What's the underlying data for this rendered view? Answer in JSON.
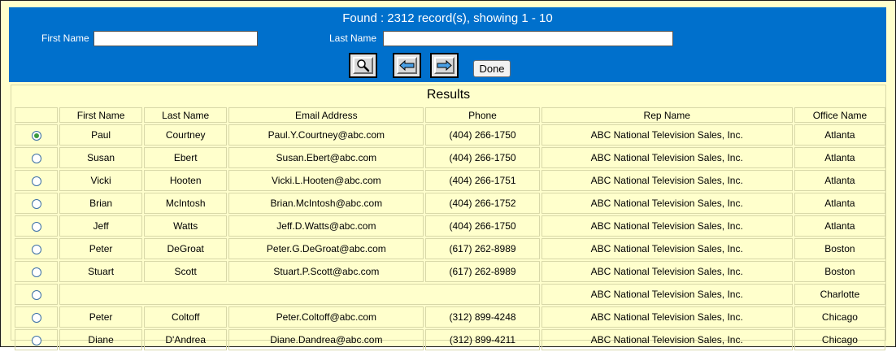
{
  "header": {
    "found_text": "Found : 2312 record(s), showing 1 - 10",
    "first_name_label": "First Name",
    "first_name_value": "",
    "last_name_label": "Last Name",
    "last_name_value": "",
    "search_icon": "magnifier-icon",
    "prev_icon": "arrow-left-icon",
    "next_icon": "arrow-right-icon",
    "done_label": "Done",
    "color": "#0070cc"
  },
  "results": {
    "title": "Results",
    "columns": [
      "",
      "First Name",
      "Last Name",
      "Email Address",
      "Phone",
      "Rep Name",
      "Office Name"
    ],
    "rows": [
      {
        "selected": true,
        "first": "Paul",
        "last": "Courtney",
        "email": "Paul.Y.Courtney@abc.com",
        "phone": "(404) 266-1750",
        "rep": "ABC National Television Sales, Inc.",
        "office": "Atlanta"
      },
      {
        "selected": false,
        "first": "Susan",
        "last": "Ebert",
        "email": "Susan.Ebert@abc.com",
        "phone": "(404) 266-1750",
        "rep": "ABC National Television Sales, Inc.",
        "office": "Atlanta"
      },
      {
        "selected": false,
        "first": "Vicki",
        "last": "Hooten",
        "email": "Vicki.L.Hooten@abc.com",
        "phone": "(404) 266-1751",
        "rep": "ABC National Television Sales, Inc.",
        "office": "Atlanta"
      },
      {
        "selected": false,
        "first": "Brian",
        "last": "McIntosh",
        "email": "Brian.McIntosh@abc.com",
        "phone": "(404) 266-1752",
        "rep": "ABC National Television Sales, Inc.",
        "office": "Atlanta"
      },
      {
        "selected": false,
        "first": "Jeff",
        "last": "Watts",
        "email": "Jeff.D.Watts@abc.com",
        "phone": "(404) 266-1750",
        "rep": "ABC National Television Sales, Inc.",
        "office": "Atlanta"
      },
      {
        "selected": false,
        "first": "Peter",
        "last": "DeGroat",
        "email": "Peter.G.DeGroat@abc.com",
        "phone": "(617) 262-8989",
        "rep": "ABC National Television Sales, Inc.",
        "office": "Boston"
      },
      {
        "selected": false,
        "first": "Stuart",
        "last": "Scott",
        "email": "Stuart.P.Scott@abc.com",
        "phone": "(617) 262-8989",
        "rep": "ABC National Television Sales, Inc.",
        "office": "Boston"
      },
      {
        "selected": false,
        "first": "",
        "last": "",
        "email": "",
        "phone": "",
        "rep": "ABC National Television Sales, Inc.",
        "office": "Charlotte"
      },
      {
        "selected": false,
        "first": "Peter",
        "last": "Coltoff",
        "email": "Peter.Coltoff@abc.com",
        "phone": "(312) 899-4248",
        "rep": "ABC National Television Sales, Inc.",
        "office": "Chicago"
      },
      {
        "selected": false,
        "first": "Diane",
        "last": "D'Andrea",
        "email": "Diane.Dandrea@abc.com",
        "phone": "(312) 899-4211",
        "rep": "ABC National Television Sales, Inc.",
        "office": "Chicago"
      }
    ]
  }
}
